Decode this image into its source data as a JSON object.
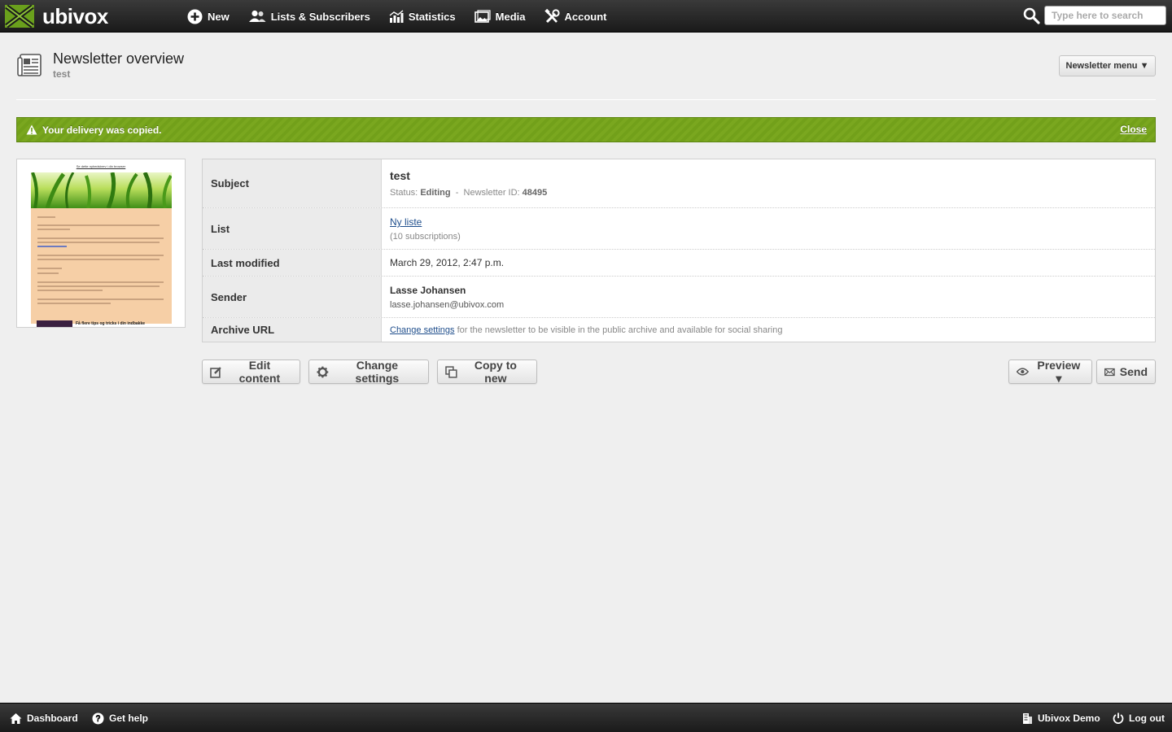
{
  "brand": {
    "name": "ubivox"
  },
  "nav": {
    "items": [
      {
        "label": "New",
        "icon": "plus-circle-icon"
      },
      {
        "label": "Lists & Subscribers",
        "icon": "users-icon"
      },
      {
        "label": "Statistics",
        "icon": "bar-chart-icon"
      },
      {
        "label": "Media",
        "icon": "image-icon"
      },
      {
        "label": "Account",
        "icon": "tools-icon"
      }
    ]
  },
  "search": {
    "placeholder": "Type here to search"
  },
  "header": {
    "title": "Newsletter overview",
    "subtitle": "test",
    "menu_label": "Newsletter menu ▼"
  },
  "alert": {
    "message": "Your delivery was copied.",
    "close_label": "Close",
    "color": "#7aa71f"
  },
  "thumbnail": {
    "top_link": "Se dette nyhedsbrev i din browser",
    "footer_text": "Få flere tips og tricks i din indbakke"
  },
  "details": {
    "subject_label": "Subject",
    "subject_value": "test",
    "status_prefix": "Status:",
    "status_value": "Editing",
    "separator": "-",
    "id_prefix": "Newsletter ID:",
    "id_value": "48495",
    "list_label": "List",
    "list_name": "Ny liste",
    "list_count": "(10 subscriptions)",
    "modified_label": "Last modified",
    "modified_value": "March 29, 2012, 2:47 p.m.",
    "sender_label": "Sender",
    "sender_name": "Lasse Johansen",
    "sender_email": "lasse.johansen@ubivox.com",
    "archive_label": "Archive URL",
    "archive_link": "Change settings",
    "archive_text": "for the newsletter to be visible in the public archive and available for social sharing"
  },
  "actions": {
    "edit": "Edit content",
    "settings": "Change settings",
    "copy": "Copy to new",
    "preview": "Preview ▾",
    "send": "Send"
  },
  "footer": {
    "dashboard": "Dashboard",
    "help": "Get help",
    "account": "Ubivox Demo",
    "logout": "Log out"
  }
}
